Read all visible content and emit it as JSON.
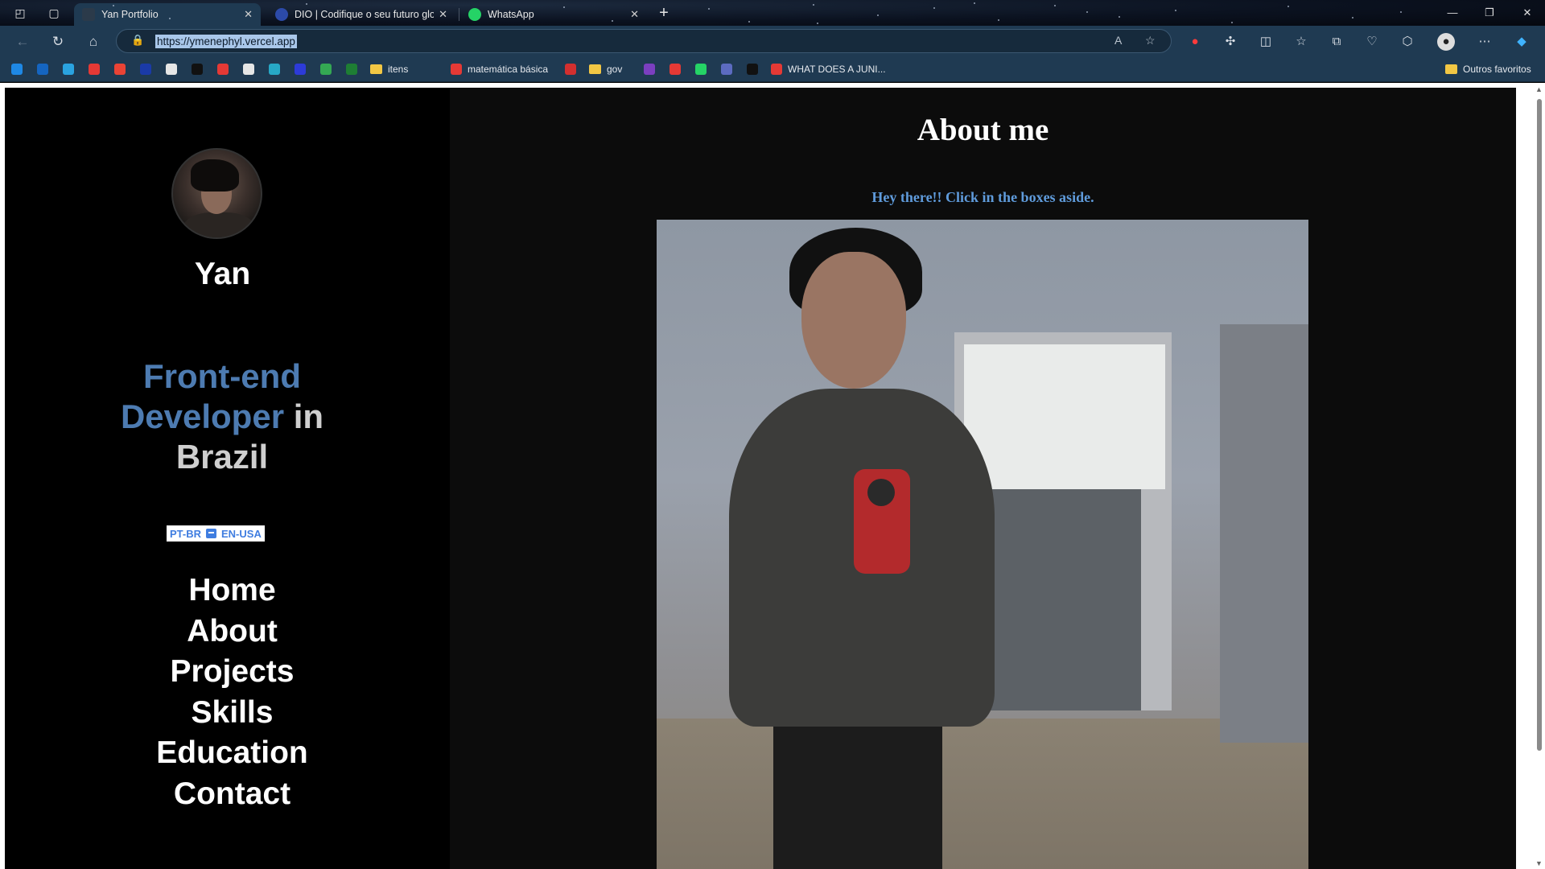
{
  "browser": {
    "tabs": [
      {
        "title": "Yan Portfolio",
        "active": true,
        "favicon_color": "#2b3a4a"
      },
      {
        "title": "DIO | Codifique o seu futuro glo",
        "active": false,
        "favicon_color": "#2c4aa8"
      },
      {
        "title": "WhatsApp",
        "active": false,
        "favicon_color": "#25d366"
      }
    ],
    "url": "https://ymenephyl.vercel.app",
    "bookmarks": [
      {
        "label": "",
        "color": "#1e88e5"
      },
      {
        "label": "",
        "color": "#1565c0"
      },
      {
        "label": "",
        "color": "#2aa3e0"
      },
      {
        "label": "",
        "color": "#e53935"
      },
      {
        "label": "",
        "color": "#ea4335"
      },
      {
        "label": "",
        "color": "#1a3aa8"
      },
      {
        "label": "",
        "color": "#e6e6e6"
      },
      {
        "label": "",
        "color": "#111111"
      },
      {
        "label": "",
        "color": "#e53935"
      },
      {
        "label": "",
        "color": "#e6e6e6"
      },
      {
        "label": "",
        "color": "#27a8c6"
      },
      {
        "label": "",
        "color": "#2d3bd8"
      },
      {
        "label": "",
        "color": "#34a853"
      },
      {
        "label": "",
        "color": "#1e7e34"
      },
      {
        "label": "itens",
        "folder": true
      },
      {
        "label": "matemática básica",
        "color": "#e53935"
      },
      {
        "label": "",
        "color": "#d32f2f"
      },
      {
        "label": "gov",
        "folder": true
      },
      {
        "label": "",
        "color": "#7b3fbf"
      },
      {
        "label": "",
        "color": "#e53935"
      },
      {
        "label": "",
        "color": "#25d366"
      },
      {
        "label": "",
        "color": "#5c6bc0"
      },
      {
        "label": "",
        "color": "#111111"
      },
      {
        "label": "WHAT DOES A JUNI...",
        "color": "#e53935"
      }
    ],
    "other_favorites": "Outros favoritos"
  },
  "sidebar": {
    "name": "Yan",
    "tagline": {
      "accent": "Front-end Developer",
      "rest1": " in",
      "rest2": "Brazil"
    },
    "lang_toggle": {
      "left": "PT-BR",
      "right": "EN-USA"
    },
    "menu": [
      "Home",
      "About",
      "Projects",
      "Skills",
      "Education",
      "Contact"
    ]
  },
  "main": {
    "title": "About me",
    "subtitle": "Hey there!! Click in the boxes aside."
  },
  "colors": {
    "accent": "#4d7bb1",
    "link": "#5f9bdb",
    "chrome": "#1f3a52"
  }
}
